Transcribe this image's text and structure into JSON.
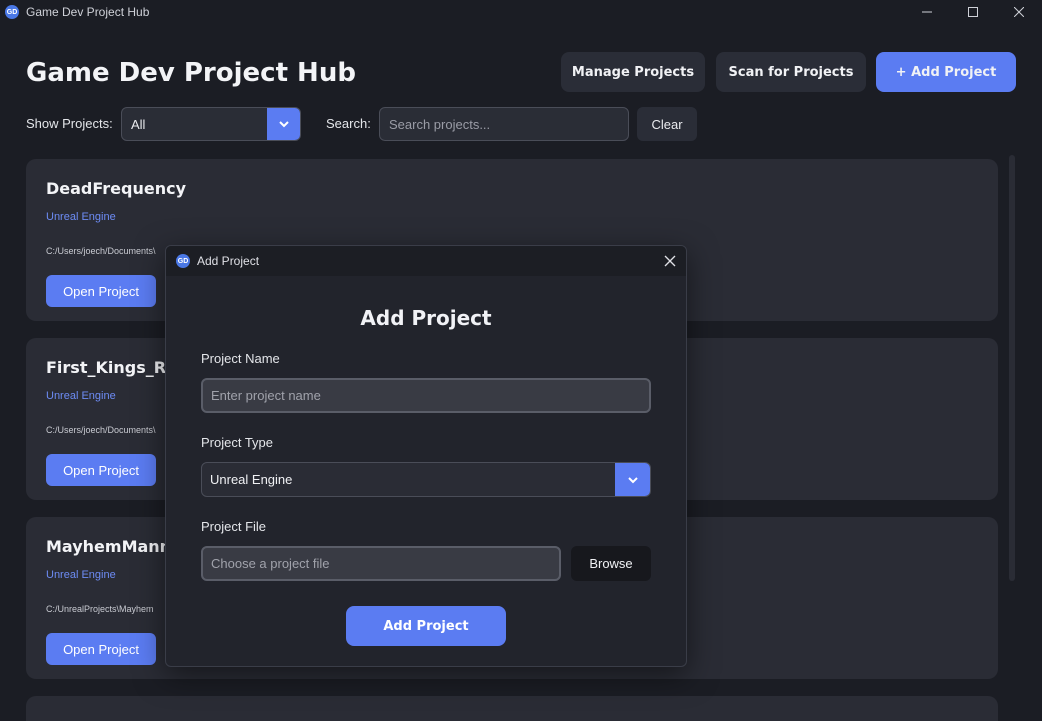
{
  "window": {
    "title": "Game Dev Project Hub"
  },
  "header": {
    "title": "Game Dev Project Hub",
    "manage_label": "Manage Projects",
    "scan_label": "Scan for Projects",
    "add_label": "+ Add Project"
  },
  "filters": {
    "show_label": "Show Projects:",
    "show_value": "All",
    "search_label": "Search:",
    "search_placeholder": "Search projects...",
    "clear_label": "Clear"
  },
  "projects": [
    {
      "name": "DeadFrequency",
      "type": "Unreal Engine",
      "path": "C:/Users/joech/Documents\\",
      "open_label": "Open Project"
    },
    {
      "name": "First_Kings_Rel",
      "type": "Unreal Engine",
      "path": "C:/Users/joech/Documents\\",
      "open_label": "Open Project"
    },
    {
      "name": "MayhemManny",
      "type": "Unreal Engine",
      "path": "C:/UnrealProjects\\Mayhem",
      "open_label": "Open Project"
    }
  ],
  "modal": {
    "window_title": "Add Project",
    "heading": "Add Project",
    "name_label": "Project Name",
    "name_placeholder": "Enter project name",
    "type_label": "Project Type",
    "type_value": "Unreal Engine",
    "file_label": "Project File",
    "file_placeholder": "Choose a project file",
    "browse_label": "Browse",
    "submit_label": "Add Project"
  },
  "colors": {
    "accent": "#5b7cf2",
    "background": "#1b1d24",
    "card": "#2a2c35",
    "engine_text": "#6d8cf5"
  },
  "icons": {
    "app": "app-logo-icon",
    "minimize": "minimize-icon",
    "maximize": "maximize-icon",
    "close": "close-icon",
    "dropdown": "chevron-down-icon"
  }
}
